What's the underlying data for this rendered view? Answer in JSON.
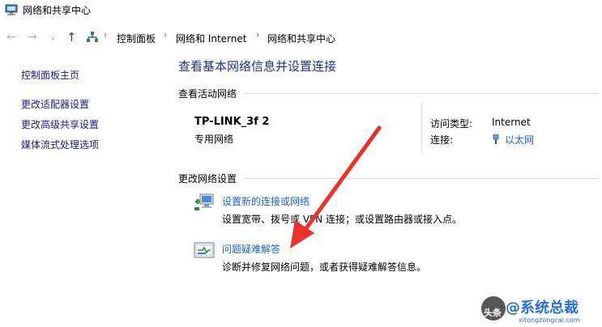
{
  "window": {
    "title": "网络和共享中心"
  },
  "navigation": {
    "back_icon": "arrow-left-icon",
    "forward_icon": "arrow-right-icon",
    "recent_icon": "chevron-down-icon",
    "up_icon": "arrow-up-icon",
    "breadcrumbs": [
      "控制面板",
      "网络和 Internet",
      "网络和共享中心"
    ]
  },
  "sidebar": {
    "items": [
      {
        "label": "控制面板主页"
      },
      {
        "label": "更改适配器设置"
      },
      {
        "label": "更改高级共享设置"
      },
      {
        "label": "媒体流式处理选项"
      }
    ]
  },
  "main": {
    "title": "查看基本网络信息并设置连接",
    "active_section": "查看活动网络",
    "network": {
      "name": "TP-LINK_3f 2",
      "category": "专用网络",
      "access_type_label": "访问类型:",
      "access_type_value": "Internet",
      "connection_label": "连接:",
      "connection_value": "以太网"
    },
    "change_section": "更改网络设置",
    "tasks": [
      {
        "label": "设置新的连接或网络",
        "description": "设置宽带、拨号或 VPN 连接；或设置路由器或接入点。",
        "icon": "new-connection-icon"
      },
      {
        "label": "问题疑难解答",
        "description": "诊断并修复网络问题，或者获得疑难解答信息。",
        "icon": "troubleshoot-icon"
      }
    ]
  },
  "annotation": {
    "color": "#e8322b"
  },
  "watermark": {
    "logo_text": "头条",
    "text": "@系统总裁",
    "sub": "xitongzongcai.com"
  },
  "colors": {
    "link": "#1a64c8",
    "title": "#1e3287",
    "separator": "#d6dce6"
  }
}
